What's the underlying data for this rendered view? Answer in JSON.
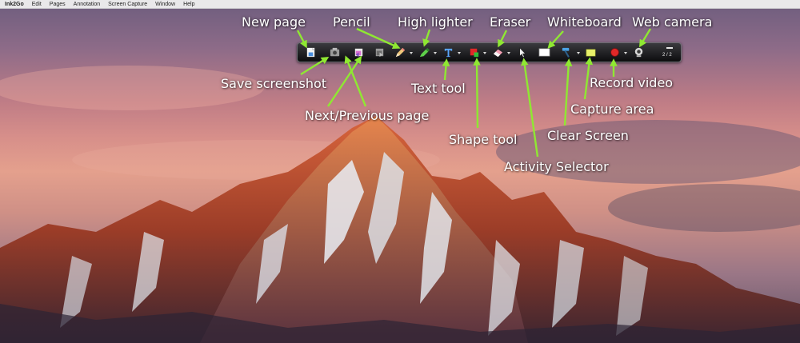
{
  "menubar": {
    "app_name": "Ink2Go",
    "items": [
      "Edit",
      "Pages",
      "Annotation",
      "Screen Capture",
      "Window",
      "Help"
    ]
  },
  "toolbar": {
    "page_indicator": "2 / 2",
    "tools": [
      {
        "name": "new-page-button",
        "icon": "new-page-icon"
      },
      {
        "name": "save-screenshot-button",
        "icon": "camera-save-icon"
      },
      {
        "name": "previous-page-button",
        "icon": "previous-page-icon"
      },
      {
        "name": "next-page-button",
        "icon": "next-page-icon"
      },
      {
        "name": "pencil-button",
        "icon": "pencil-icon"
      },
      {
        "name": "highlighter-button",
        "icon": "highlighter-icon"
      },
      {
        "name": "text-tool-button",
        "icon": "text-t-icon"
      },
      {
        "name": "shape-tool-button",
        "icon": "shape-icon"
      },
      {
        "name": "eraser-button",
        "icon": "eraser-icon"
      },
      {
        "name": "activity-selector-button",
        "icon": "cursor-arrow-icon"
      },
      {
        "name": "whiteboard-button",
        "icon": "whiteboard-icon"
      },
      {
        "name": "clear-screen-button",
        "icon": "hammer-icon"
      },
      {
        "name": "capture-area-button",
        "icon": "capture-area-icon"
      },
      {
        "name": "record-video-button",
        "icon": "record-icon"
      },
      {
        "name": "web-camera-button",
        "icon": "webcam-icon"
      }
    ]
  },
  "annotations": {
    "new_page": "New page",
    "pencil": "Pencil",
    "highlighter": "High lighter",
    "eraser": "Eraser",
    "whiteboard": "Whiteboard",
    "web_camera": "Web camera",
    "save_screenshot": "Save screenshot",
    "text_tool": "Text tool",
    "record_video": "Record video",
    "next_previous_page": "Next/Previous page",
    "capture_area": "Capture area",
    "clear_screen": "Clear Screen",
    "shape_tool": "Shape tool",
    "activity_selector": "Activity Selector"
  },
  "colors": {
    "arrow": "#8fe832",
    "toolbar_bg": "#1a1a1c",
    "label_text": "#ffffff"
  }
}
